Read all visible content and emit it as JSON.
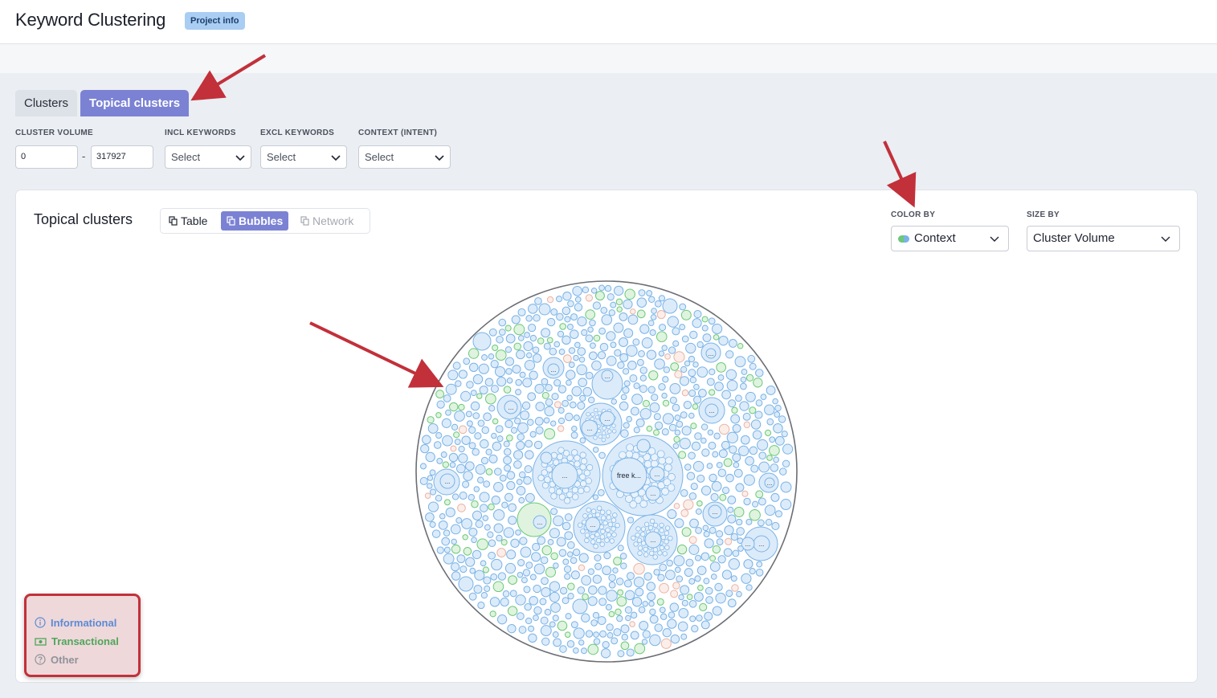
{
  "header": {
    "title": "Keyword Clustering",
    "project_badge": "Project info"
  },
  "tabs": [
    {
      "label": "Clusters",
      "active": false
    },
    {
      "label": "Topical clusters",
      "active": true
    }
  ],
  "filters": {
    "cluster_volume_label": "CLUSTER VOLUME",
    "volume_min": "0",
    "volume_max": "317927",
    "range_separator": "-",
    "incl_keywords_label": "INCL KEYWORDS",
    "incl_keywords_value": "Select",
    "excl_keywords_label": "EXCL KEYWORDS",
    "excl_keywords_value": "Select",
    "context_label": "CONTEXT (INTENT)",
    "context_value": "Select"
  },
  "panel": {
    "title": "Topical clusters",
    "views": [
      {
        "label": "Table",
        "active": false,
        "enabled": true
      },
      {
        "label": "Bubbles",
        "active": true,
        "enabled": true
      },
      {
        "label": "Network",
        "active": false,
        "enabled": false
      }
    ],
    "color_by_label": "COLOR BY",
    "color_by_value": "Context",
    "size_by_label": "SIZE BY",
    "size_by_value": "Cluster Volume"
  },
  "legend": {
    "informational": "Informational",
    "transactional": "Transactional",
    "other": "Other"
  },
  "bubble_labels": {
    "main": "free k...",
    "truncated": "..."
  },
  "colors": {
    "accent": "#7b82d4",
    "informational": "#7ab3e6",
    "transactional": "#6cc97a",
    "other": "#e8b4a8",
    "annotation": "#c2303a"
  },
  "icons": {
    "table_view": "copy-icon",
    "bubbles_view": "copy-icon",
    "network_view": "copy-icon",
    "informational": "info-circle-icon",
    "transactional": "money-icon",
    "other": "question-circle-icon",
    "dropdown": "chevron-down-icon"
  }
}
